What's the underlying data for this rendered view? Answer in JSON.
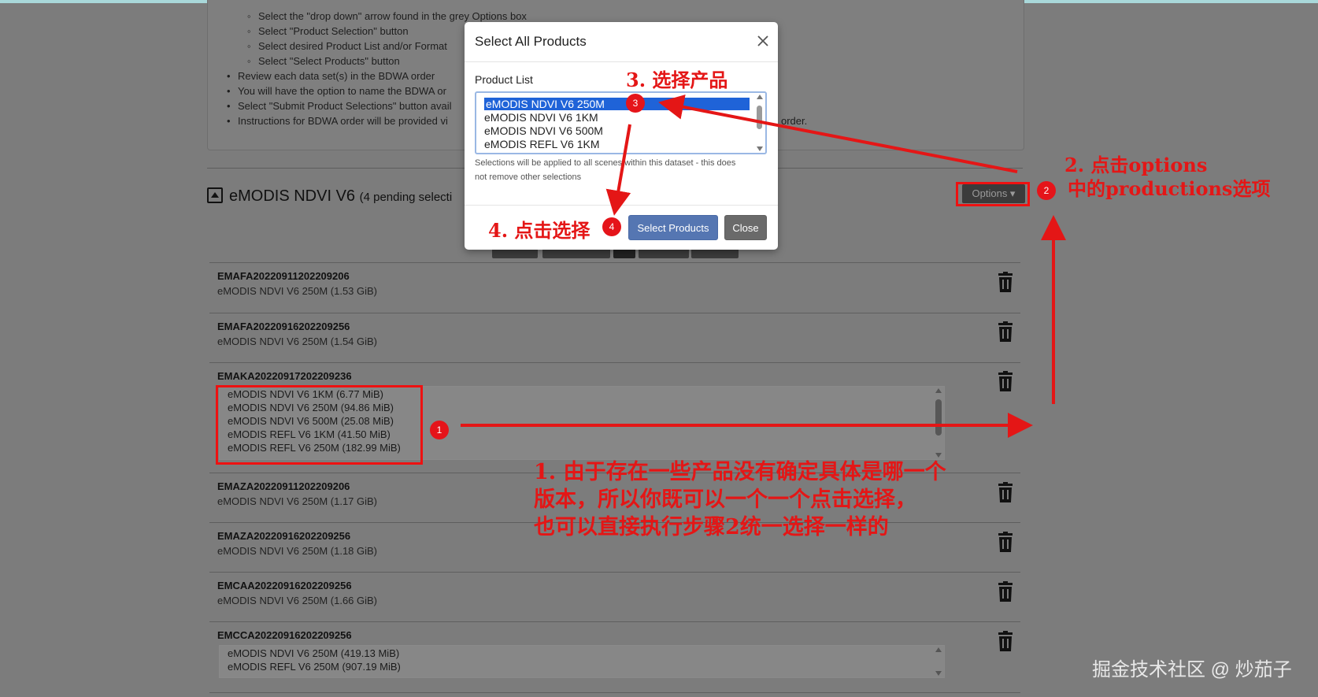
{
  "instructions": {
    "sub_items": [
      "Select the \"drop down\" arrow found in the grey Options box",
      "Select \"Product Selection\" button",
      "Select desired Product List and/or Format",
      "Select \"Select Products\" button"
    ],
    "bullets": [
      "Review each data set(s) in the BDWA order",
      "You will have the option to name the BDWA or",
      "Select \"Submit Product Selections\" button avail",
      "Instructions for BDWA order will be provided vi"
    ],
    "bullet_tail": "order."
  },
  "section": {
    "title": "eMODIS NDVI V6",
    "pending": "(4 pending selecti",
    "options_label": "Options ▾"
  },
  "rows": [
    {
      "id": "EMAFA20220911202209206",
      "sub": "eMODIS NDVI V6 250M (1.53 GiB)"
    },
    {
      "id": "EMAFA20220916202209256",
      "sub": "eMODIS NDVI V6 250M (1.54 GiB)"
    },
    {
      "id": "EMAKA20220917202209236",
      "options": [
        "eMODIS NDVI V6 1KM (6.77 MiB)",
        "eMODIS NDVI V6 250M (94.86 MiB)",
        "eMODIS NDVI V6 500M (25.08 MiB)",
        "eMODIS REFL V6 1KM (41.50 MiB)",
        "eMODIS REFL V6 250M (182.99 MiB)"
      ]
    },
    {
      "id": "EMAZA20220911202209206",
      "sub": "eMODIS NDVI V6 250M (1.17 GiB)"
    },
    {
      "id": "EMAZA20220916202209256",
      "sub": "eMODIS NDVI V6 250M (1.18 GiB)"
    },
    {
      "id": "EMCAA20220916202209256",
      "sub": "eMODIS NDVI V6 250M (1.66 GiB)"
    },
    {
      "id": "EMCCA20220916202209256",
      "options": [
        "eMODIS NDVI V6 250M (419.13 MiB)",
        "eMODIS REFL V6 250M (907.19 MiB)"
      ]
    }
  ],
  "modal": {
    "title": "Select All Products",
    "label": "Product List",
    "options": [
      "eMODIS NDVI V6 250M",
      "eMODIS NDVI V6 1KM",
      "eMODIS NDVI V6 500M",
      "eMODIS REFL V6 1KM"
    ],
    "help_line1": "Selections will be applied to all scenes within this dataset - this does",
    "help_line2": "not remove other selections",
    "select_label": "Select Products",
    "close_label": "Close"
  },
  "annotations": {
    "markers": [
      "1",
      "2",
      "3",
      "4"
    ],
    "step1_lines": [
      "1. 由于存在一些产品没有确定具体是哪一个",
      "版本，所以你既可以一个一个点击选择，",
      "也可以直接执行步骤2统一选择一样的"
    ],
    "step2_lines": [
      "2. 点击options",
      "中的productions选项"
    ],
    "step3": "3. 选择产品",
    "step4": "4. 点击选择",
    "watermark": "掘金技术社区 @ 炒茄子",
    "color": "#e41616"
  }
}
